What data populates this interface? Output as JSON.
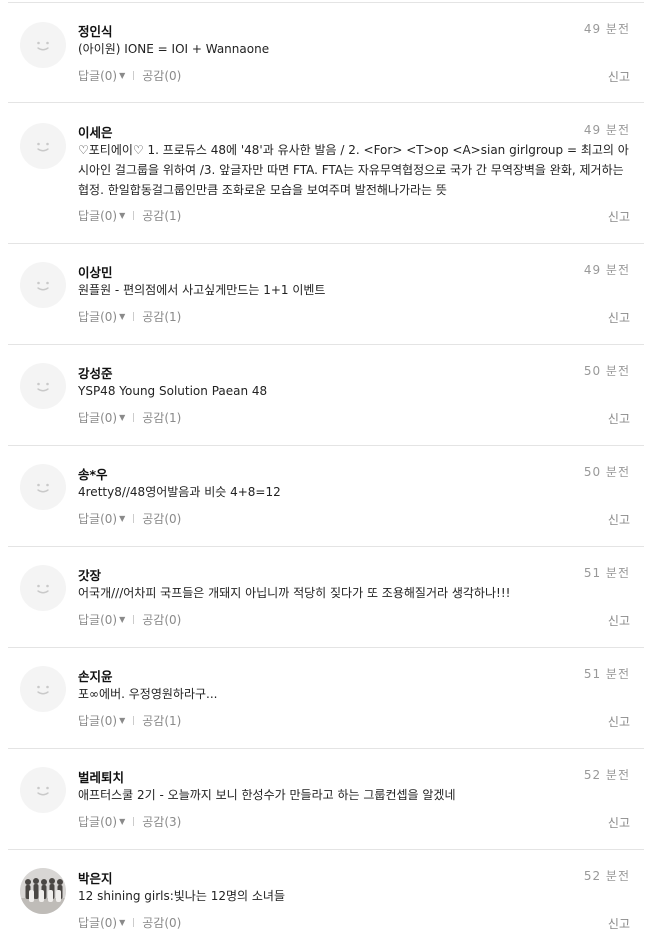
{
  "comments": [
    {
      "author": "정인식",
      "time": "49 분전",
      "text": "(아이원) IONE = IOI + Wannaone",
      "reply_label": "답글(0)",
      "like_label": "공감(0)",
      "report_label": "신고",
      "avatar": "default-face-icon"
    },
    {
      "author": "이세은",
      "time": "49 분전",
      "text": "♡포티에이♡ 1. 프로듀스 48에 '48'과 유사한 발음 / 2. <For> <T>op <A>sian girlgroup = 최고의 아시아인 걸그룹을 위하여 /3. 앞글자만 따면 FTA. FTA는 자유무역협정으로 국가 간 무역장벽을 완화, 제거하는 협정. 한일합동걸그룹인만큼 조화로운 모습을 보여주며 발전해나가라는 뜻",
      "reply_label": "답글(0)",
      "like_label": "공감(1)",
      "report_label": "신고",
      "avatar": "default-face-icon"
    },
    {
      "author": "이상민",
      "time": "49 분전",
      "text": "원플원 - 편의점에서 사고싶게만드는 1+1 이벤트",
      "reply_label": "답글(0)",
      "like_label": "공감(1)",
      "report_label": "신고",
      "avatar": "default-face-icon"
    },
    {
      "author": "강성준",
      "time": "50 분전",
      "text": "YSP48 Young Solution Paean 48",
      "reply_label": "답글(0)",
      "like_label": "공감(1)",
      "report_label": "신고",
      "avatar": "default-face-icon"
    },
    {
      "author": "송*우",
      "time": "50 분전",
      "text": "4retty8//48영어발음과 비슷 4+8=12",
      "reply_label": "답글(0)",
      "like_label": "공감(0)",
      "report_label": "신고",
      "avatar": "default-face-icon"
    },
    {
      "author": "갓장",
      "time": "51 분전",
      "text": "어국개///어차피 국프들은 개돼지 아닙니까 적당히 짖다가 또 조용해질거라 생각하나!!!",
      "reply_label": "답글(0)",
      "like_label": "공감(0)",
      "report_label": "신고",
      "avatar": "default-face-icon"
    },
    {
      "author": "손지윤",
      "time": "51 분전",
      "text": "포∞에버. 우정영원하라구...",
      "reply_label": "답글(0)",
      "like_label": "공감(1)",
      "report_label": "신고",
      "avatar": "default-face-icon"
    },
    {
      "author": "벌레퇴치",
      "time": "52 분전",
      "text": "애프터스쿨 2기 - 오늘까지 보니 한성수가 만들라고 하는 그룹컨셉을 알겠네",
      "reply_label": "답글(0)",
      "like_label": "공감(3)",
      "report_label": "신고",
      "avatar": "default-face-icon"
    },
    {
      "author": "박은지",
      "time": "52 분전",
      "text": "12 shining girls:빛나는 12명의 소녀들",
      "reply_label": "답글(0)",
      "like_label": "공감(0)",
      "report_label": "신고",
      "avatar": "group-photo"
    }
  ]
}
